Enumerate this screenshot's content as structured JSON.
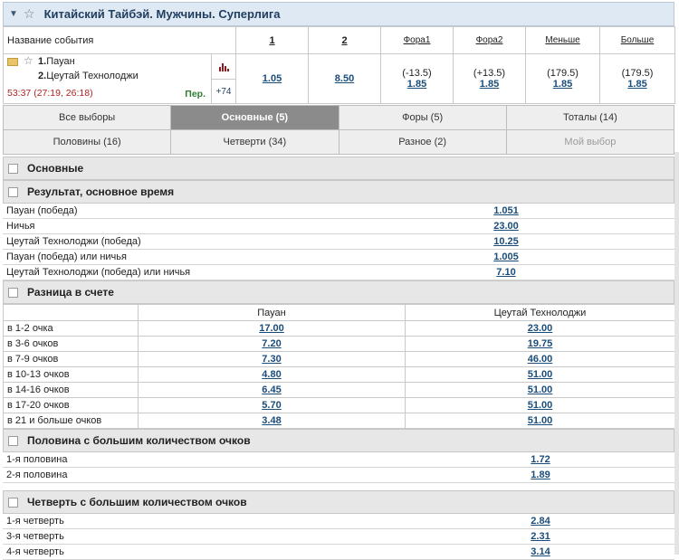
{
  "league": {
    "title": "Китайский Тайбэй. Мужчины. Суперлига"
  },
  "event_header": {
    "name_label": "Название события",
    "col1": "1",
    "col2": "2",
    "col3": "Фора1",
    "col4": "Фора2",
    "col5": "Меньше",
    "col6": "Больше"
  },
  "event": {
    "team1_num": "1.",
    "team1": "Пауан",
    "team2_num": "2.",
    "team2": "Цеутай Технолоджи",
    "score": "53:37 (27:19, 26:18)",
    "period": "Пер.",
    "more": "+74",
    "odd1": "1.05",
    "odd2": "8.50",
    "hcap1": "(-13.5)",
    "hcap1_odd": "1.85",
    "hcap2": "(+13.5)",
    "hcap2_odd": "1.85",
    "under": "(179.5)",
    "under_odd": "1.85",
    "over": "(179.5)",
    "over_odd": "1.85"
  },
  "tabs": {
    "row1": [
      "Все выборы",
      "Основные (5)",
      "Форы (5)",
      "Тоталы (14)"
    ],
    "row2": [
      "Половины (16)",
      "Четверти (34)",
      "Разное (2)",
      "Мой выбор"
    ]
  },
  "sections": {
    "main": "Основные",
    "result": {
      "title": "Результат, основное время",
      "rows": [
        {
          "label": "Пауан (победа)",
          "odd": "1.051"
        },
        {
          "label": "Ничья",
          "odd": "23.00"
        },
        {
          "label": "Цеутай Технолоджи (победа)",
          "odd": "10.25"
        },
        {
          "label": "Пауан (победа) или ничья",
          "odd": "1.005"
        },
        {
          "label": "Цеутай Технолоджи (победа) или ничья",
          "odd": "7.10"
        }
      ]
    },
    "diff": {
      "title": "Разница в счете",
      "col1": "Пауан",
      "col2": "Цеутай Технолоджи",
      "rows": [
        {
          "label": "в 1-2 очка",
          "a": "17.00",
          "b": "23.00"
        },
        {
          "label": "в 3-6 очков",
          "a": "7.20",
          "b": "19.75"
        },
        {
          "label": "в 7-9 очков",
          "a": "7.30",
          "b": "46.00"
        },
        {
          "label": "в 10-13 очков",
          "a": "4.80",
          "b": "51.00"
        },
        {
          "label": "в 14-16 очков",
          "a": "6.45",
          "b": "51.00"
        },
        {
          "label": "в 17-20 очков",
          "a": "5.70",
          "b": "51.00"
        },
        {
          "label": "в 21 и больше очков",
          "a": "3.48",
          "b": "51.00"
        }
      ]
    },
    "half": {
      "title": "Половина с большим количеством очков",
      "rows": [
        {
          "label": "1-я половина",
          "odd": "1.72"
        },
        {
          "label": "2-я половина",
          "odd": "1.89"
        }
      ]
    },
    "quarter": {
      "title": "Четверть с большим количеством очков",
      "rows": [
        {
          "label": "1-я четверть",
          "odd": "2.84"
        },
        {
          "label": "3-я четверть",
          "odd": "2.31"
        },
        {
          "label": "4-я четверть",
          "odd": "3.14"
        }
      ]
    }
  }
}
